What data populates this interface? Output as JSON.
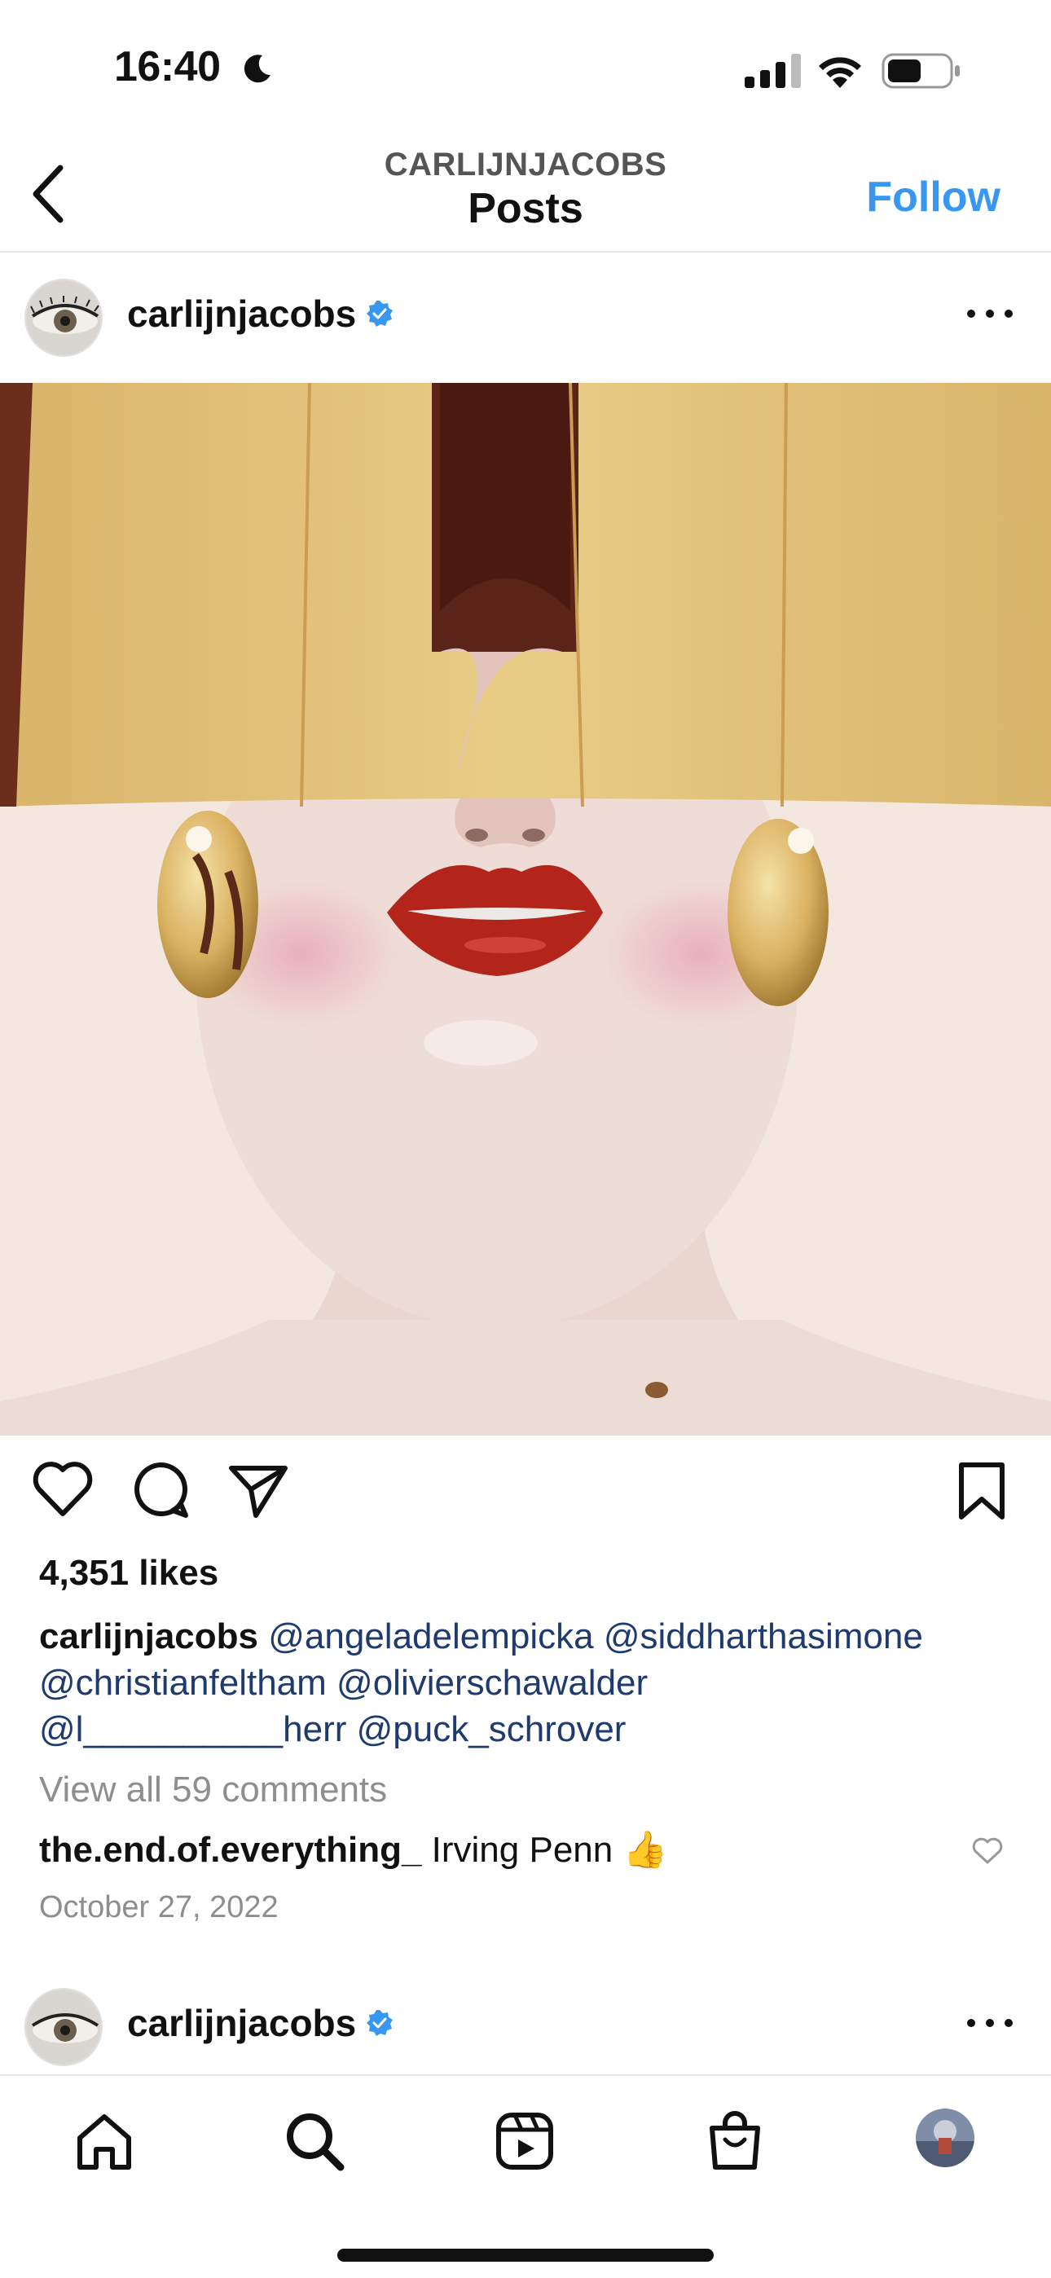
{
  "status_bar": {
    "time": "16:40"
  },
  "nav": {
    "subtitle": "CARLIJNJACOBS",
    "title": "Posts",
    "follow_label": "Follow"
  },
  "post": {
    "username": "carlijnjacobs",
    "likes": "4,351 likes",
    "caption_user": "carlijnjacobs",
    "tags": [
      "@angeladelempicka",
      "@siddharthasimone",
      "@christianfeltham",
      "@olivierschawalder",
      "@l__________herr",
      "@puck_schrover"
    ],
    "view_all_comments": "View all 59 comments",
    "comment": {
      "user": "the.end.of.everything_",
      "text": "Irving Penn 👍"
    },
    "date": "October 27, 2022"
  },
  "next_post": {
    "username": "carlijnjacobs"
  },
  "colors": {
    "accent": "#3897f0",
    "tag": "#1e3a6e",
    "muted": "#8e8e8e",
    "verified": "#3897f0"
  },
  "icons": [
    "moon-icon",
    "signal-icon",
    "wifi-icon",
    "battery-icon",
    "back-icon",
    "verified-icon",
    "more-icon",
    "heart-icon",
    "comment-icon",
    "share-icon",
    "bookmark-icon",
    "home-icon",
    "search-icon",
    "reels-icon",
    "shop-icon"
  ]
}
